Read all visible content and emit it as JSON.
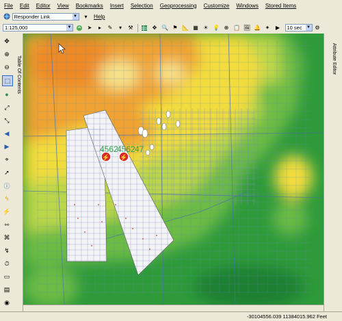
{
  "menu": [
    "File",
    "Edit",
    "Editor",
    "View",
    "Bookmarks",
    "Insert",
    "Selection",
    "Geoprocessing",
    "Customize",
    "Windows",
    "Stored Items"
  ],
  "toolbar1": {
    "layer_combo": "Responder Link",
    "help_label": "Help"
  },
  "toolbar2": {
    "scale": "1:125,000",
    "refresh_interval": "10 sec"
  },
  "left_panel": {
    "toc_tab": "Table Of Contents"
  },
  "right_panel": {
    "attribute_tab": "Attribute Editor"
  },
  "map": {
    "unit_labels": [
      "4562",
      "4562",
      "47"
    ]
  },
  "status": {
    "coordinates": "-30104556.039  11384015.962 Feet"
  },
  "colors": {
    "high": "#f09a30",
    "mid": "#f3dc3c",
    "low": "#2e9a3a"
  }
}
